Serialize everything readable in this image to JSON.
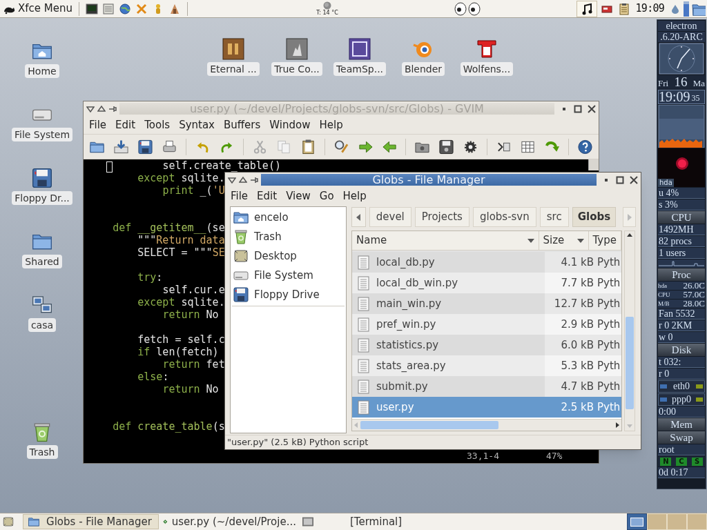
{
  "top_panel": {
    "menu_label": "Xfce Menu",
    "weather": "T: 14 °C",
    "clock": "19:09"
  },
  "desktop_icons_top": [
    {
      "label": "Eternal ..."
    },
    {
      "label": "True Co..."
    },
    {
      "label": "TeamSp..."
    },
    {
      "label": "Blender"
    },
    {
      "label": "Wolfens..."
    }
  ],
  "desktop_icons_left": [
    {
      "label": "Home"
    },
    {
      "label": "File System"
    },
    {
      "label": "Floppy Dr..."
    },
    {
      "label": "Shared"
    },
    {
      "label": "casa"
    },
    {
      "label": "Trash"
    }
  ],
  "gvim": {
    "title": "user.py (~/devel/Projects/globs-svn/src/Globs) - GVIM",
    "active": false,
    "menu": [
      "File",
      "Edit",
      "Tools",
      "Syntax",
      "Buffers",
      "Window",
      "Help"
    ],
    "code": [
      {
        "kind": "code",
        "segments": [
          {
            "kind": "plain",
            "text": "            self.create_table()"
          }
        ]
      },
      {
        "kind": "code",
        "segments": [
          {
            "kind": "keyword",
            "text": "        except"
          },
          {
            "kind": "plain",
            "text": " sqlite."
          }
        ]
      },
      {
        "kind": "code",
        "segments": [
          {
            "kind": "keyword",
            "text": "            print"
          },
          {
            "kind": "plain",
            "text": " _("
          },
          {
            "kind": "string",
            "text": "'U"
          }
        ]
      },
      {
        "kind": "blank"
      },
      {
        "kind": "blank"
      },
      {
        "kind": "code",
        "segments": [
          {
            "kind": "keyword",
            "text": "    def"
          },
          {
            "kind": "function",
            "text": " __getitem__"
          },
          {
            "kind": "plain",
            "text": "(se"
          }
        ]
      },
      {
        "kind": "code",
        "segments": [
          {
            "kind": "plain",
            "text": "        \"\"\""
          },
          {
            "kind": "string",
            "text": "Return data"
          }
        ]
      },
      {
        "kind": "code",
        "segments": [
          {
            "kind": "plain",
            "text": "        SELECT = \"\"\""
          },
          {
            "kind": "string",
            "text": "SE"
          }
        ]
      },
      {
        "kind": "blank"
      },
      {
        "kind": "code",
        "segments": [
          {
            "kind": "keyword",
            "text": "        try"
          },
          {
            "kind": "plain",
            "text": ":"
          }
        ]
      },
      {
        "kind": "code",
        "segments": [
          {
            "kind": "plain",
            "text": "            self.cur.e"
          }
        ]
      },
      {
        "kind": "code",
        "segments": [
          {
            "kind": "keyword",
            "text": "        except"
          },
          {
            "kind": "plain",
            "text": " sqlite."
          }
        ]
      },
      {
        "kind": "code",
        "segments": [
          {
            "kind": "keyword",
            "text": "            return"
          },
          {
            "kind": "plain",
            "text": " No"
          }
        ]
      },
      {
        "kind": "blank"
      },
      {
        "kind": "code",
        "segments": [
          {
            "kind": "plain",
            "text": "        fetch = self.c"
          }
        ]
      },
      {
        "kind": "code",
        "segments": [
          {
            "kind": "keyword",
            "text": "        if"
          },
          {
            "kind": "plain",
            "text": " len(fetch)"
          }
        ]
      },
      {
        "kind": "code",
        "segments": [
          {
            "kind": "keyword",
            "text": "            return"
          },
          {
            "kind": "plain",
            "text": " fet"
          }
        ]
      },
      {
        "kind": "code",
        "segments": [
          {
            "kind": "keyword",
            "text": "        else"
          },
          {
            "kind": "plain",
            "text": ":"
          }
        ]
      },
      {
        "kind": "code",
        "segments": [
          {
            "kind": "keyword",
            "text": "            return"
          },
          {
            "kind": "plain",
            "text": " No"
          }
        ]
      },
      {
        "kind": "blank"
      },
      {
        "kind": "blank"
      },
      {
        "kind": "code",
        "segments": [
          {
            "kind": "keyword",
            "text": "    def"
          },
          {
            "kind": "function",
            "text": " create_table"
          },
          {
            "kind": "plain",
            "text": "(s"
          }
        ]
      }
    ],
    "cursor_position": "33,1-4",
    "scroll_percent": "47%"
  },
  "file_manager": {
    "title": "Globs - File Manager",
    "active": true,
    "menu": [
      "File",
      "Edit",
      "View",
      "Go",
      "Help"
    ],
    "places": [
      {
        "label": "encelo"
      },
      {
        "label": "Trash"
      },
      {
        "label": "Desktop"
      },
      {
        "label": "File System"
      },
      {
        "label": "Floppy Drive"
      }
    ],
    "path": [
      {
        "label": "devel",
        "selected": false
      },
      {
        "label": "Projects",
        "selected": false
      },
      {
        "label": "globs-svn",
        "selected": false
      },
      {
        "label": "src",
        "selected": false
      },
      {
        "label": "Globs",
        "selected": true
      }
    ],
    "columns": [
      "Name",
      "Size",
      "Type"
    ],
    "rows": [
      {
        "name": "local_db.py",
        "size": "4.1 kB",
        "type": "Pyth",
        "selected": false
      },
      {
        "name": "local_db_win.py",
        "size": "7.7 kB",
        "type": "Pyth",
        "selected": false
      },
      {
        "name": "main_win.py",
        "size": "12.7 kB",
        "type": "Pyth",
        "selected": false
      },
      {
        "name": "pref_win.py",
        "size": "2.9 kB",
        "type": "Pyth",
        "selected": false
      },
      {
        "name": "statistics.py",
        "size": "6.0 kB",
        "type": "Pyth",
        "selected": false
      },
      {
        "name": "stats_area.py",
        "size": "5.3 kB",
        "type": "Pyth",
        "selected": false
      },
      {
        "name": "submit.py",
        "size": "4.7 kB",
        "type": "Pyth",
        "selected": false
      },
      {
        "name": "user.py",
        "size": "2.5 kB",
        "type": "Pyth",
        "selected": true
      }
    ],
    "status": "\"user.py\" (2.5 kB) Python script"
  },
  "gkrellm": [
    {
      "kind": "host",
      "text": "electron"
    },
    {
      "kind": "host",
      "text": ".6.20-ARC"
    },
    {
      "kind": "clock"
    },
    {
      "kind": "date",
      "day": "Fri",
      "date": "16",
      "month": "Ma"
    },
    {
      "kind": "time",
      "time": "19:09",
      "seconds": "35"
    },
    {
      "kind": "chart"
    },
    {
      "kind": "disk-chart",
      "label": "hda"
    },
    {
      "kind": "readout",
      "text": "u 4%"
    },
    {
      "kind": "readout",
      "text": "s 3%"
    },
    {
      "kind": "header",
      "text": "CPU"
    },
    {
      "kind": "readout",
      "text": "1492MH"
    },
    {
      "kind": "readout",
      "text": "82 procs"
    },
    {
      "kind": "readout",
      "text": " 1 users"
    },
    {
      "kind": "spark"
    },
    {
      "kind": "header",
      "text": "Proc"
    },
    {
      "kind": "sensor",
      "label": "hda",
      "text": "26.0C"
    },
    {
      "kind": "sensor",
      "label": "CPU",
      "text": "57.0C"
    },
    {
      "kind": "sensor",
      "label": "M/B",
      "text": "28.0C"
    },
    {
      "kind": "readout",
      "text": "Fan 5532"
    },
    {
      "kind": "readout",
      "text": "r 0 2KM"
    },
    {
      "kind": "readout",
      "text": "w 0"
    },
    {
      "kind": "header",
      "text": "Disk"
    },
    {
      "kind": "readout",
      "text": "t 032:"
    },
    {
      "kind": "readout",
      "text": "r 0"
    },
    {
      "kind": "net",
      "text": "eth0"
    },
    {
      "kind": "net",
      "text": "ppp0"
    },
    {
      "kind": "readout",
      "text": "0:00"
    },
    {
      "kind": "header",
      "text": "Mem"
    },
    {
      "kind": "header",
      "text": "Swap"
    },
    {
      "kind": "readout",
      "text": "root"
    },
    {
      "kind": "leds",
      "leds": [
        "N",
        "C",
        "S"
      ]
    },
    {
      "kind": "readout",
      "text": "0d 0:17"
    }
  ],
  "taskbar": {
    "tasks": [
      {
        "label": "Globs - File Manager",
        "selected": true
      },
      {
        "label": "user.py (~/devel/Proje...",
        "selected": false
      },
      {
        "label": "[Terminal]",
        "selected": false
      }
    ],
    "workspaces": [
      {
        "selected": true
      },
      {
        "selected": false
      },
      {
        "selected": false
      },
      {
        "selected": false
      }
    ]
  }
}
